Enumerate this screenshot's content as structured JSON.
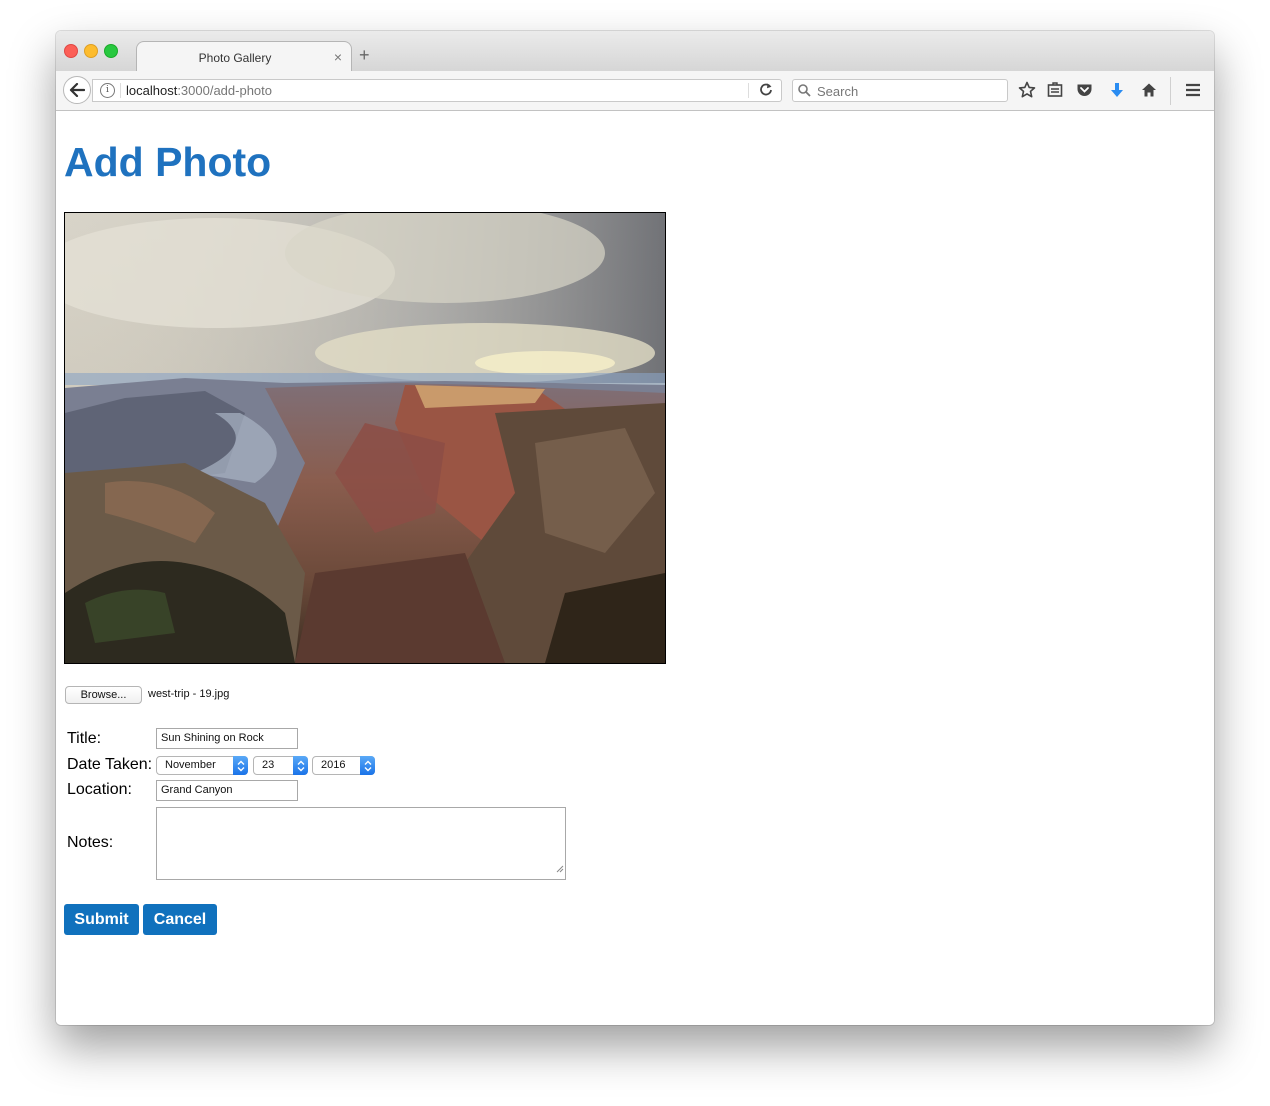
{
  "browser": {
    "tab_title": "Photo Gallery",
    "tab_close": "×",
    "new_tab": "+",
    "url_host": "localhost",
    "url_rest": ":3000/add-photo",
    "search_placeholder": "Search"
  },
  "page": {
    "heading": "Add Photo",
    "file": {
      "browse_label": "Browse...",
      "file_name": "west-trip - 19.jpg"
    },
    "form": {
      "title_label": "Title:",
      "title_value": "Sun Shining on Rock",
      "date_label": "Date Taken:",
      "month": "November",
      "day": "23",
      "year": "2016",
      "location_label": "Location:",
      "location_value": "Grand Canyon",
      "notes_label": "Notes:",
      "notes_value": ""
    },
    "buttons": {
      "submit": "Submit",
      "cancel": "Cancel"
    }
  },
  "colors": {
    "heading": "#1f72bf",
    "button": "#1071bd",
    "download_arrow": "#2a8cf1"
  }
}
